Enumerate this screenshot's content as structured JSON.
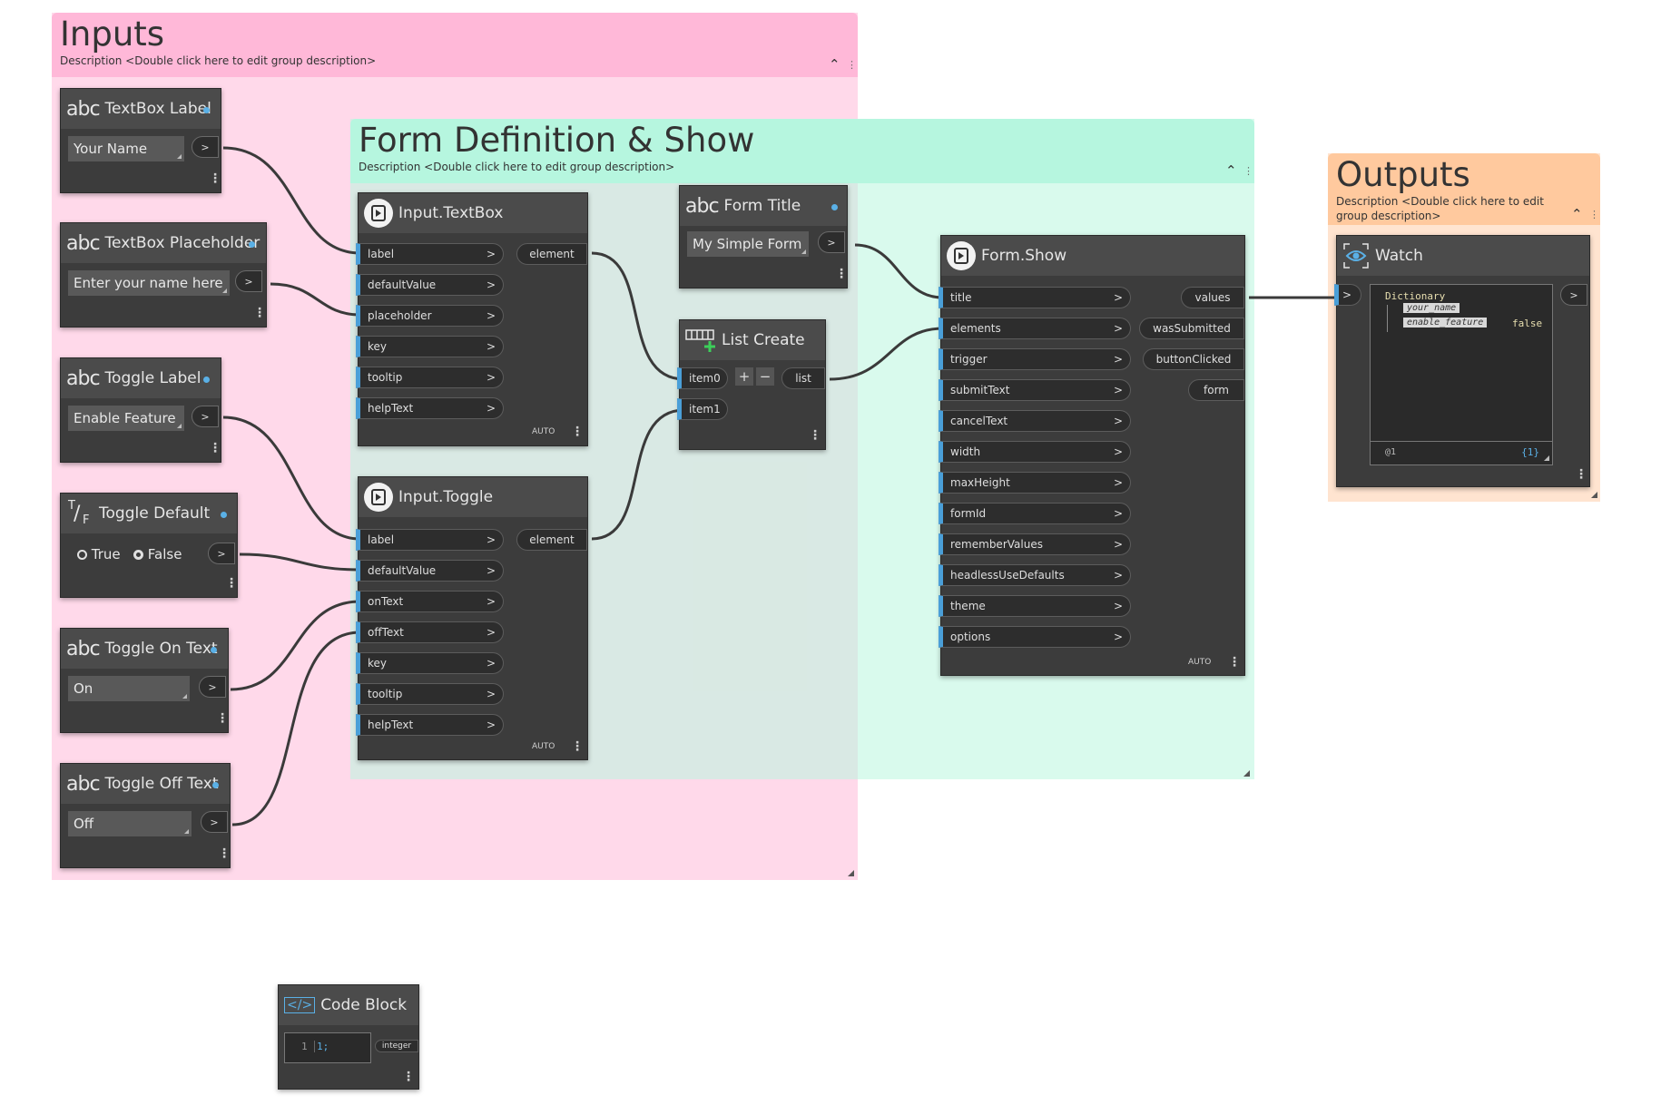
{
  "groups": {
    "inputs": {
      "title": "Inputs",
      "description": "Description <Double click here to edit group description>",
      "color": "#ffb8d8",
      "body_color": "#ffd9ea"
    },
    "form": {
      "title": "Form Definition & Show",
      "description": "Description <Double click here to edit group description>",
      "color": "#b6f6df",
      "body_color": "#dafaee"
    },
    "outputs": {
      "title": "Outputs",
      "description": "Description <Double click here to edit group description>",
      "color": "#ffc99e",
      "body_color": "#ffe4d0"
    }
  },
  "nodes": {
    "textbox_label": {
      "type_icon": "abc",
      "title": "TextBox Label",
      "value": "Your Name",
      "out": ">"
    },
    "textbox_placeholder": {
      "type_icon": "abc",
      "title": "TextBox Placeholder",
      "value": "Enter your name here",
      "out": ">"
    },
    "toggle_label": {
      "type_icon": "abc",
      "title": "Toggle Label",
      "value": "Enable Feature",
      "out": ">"
    },
    "toggle_default": {
      "type_icon": "T/F",
      "icon_t": "T",
      "icon_f": "F",
      "title": "Toggle Default",
      "true_label": "True",
      "false_label": "False",
      "out": ">"
    },
    "toggle_on_text": {
      "type_icon": "abc",
      "title": "Toggle On Text",
      "value": "On",
      "out": ">"
    },
    "toggle_off_text": {
      "type_icon": "abc",
      "title": "Toggle Off Text",
      "value": "Off",
      "out": ">"
    },
    "input_textbox": {
      "title": "Input.TextBox",
      "inputs": [
        "label",
        "defaultValue",
        "placeholder",
        "key",
        "tooltip",
        "helpText"
      ],
      "output": "element",
      "lacing": "AUTO"
    },
    "input_toggle": {
      "title": "Input.Toggle",
      "inputs": [
        "label",
        "defaultValue",
        "onText",
        "offText",
        "key",
        "tooltip",
        "helpText"
      ],
      "output": "element",
      "lacing": "AUTO"
    },
    "form_title": {
      "type_icon": "abc",
      "title": "Form Title",
      "value": "My Simple Form",
      "out": ">"
    },
    "list_create": {
      "title": "List Create",
      "inputs": [
        "item0",
        "item1"
      ],
      "output": "list",
      "add": "+",
      "remove": "−"
    },
    "form_show": {
      "title": "Form.Show",
      "inputs": [
        "title",
        "elements",
        "trigger",
        "submitText",
        "cancelText",
        "width",
        "maxHeight",
        "formId",
        "rememberValues",
        "headlessUseDefaults",
        "theme",
        "options"
      ],
      "outputs": [
        "values",
        "wasSubmitted",
        "buttonClicked",
        "form"
      ],
      "lacing": "AUTO"
    },
    "watch": {
      "title": "Watch",
      "in": ">",
      "out": ">",
      "tree_root": "Dictionary",
      "keys": [
        "your_name",
        "enable_feature"
      ],
      "value_enable_feature": "false",
      "footer_left": "@1",
      "footer_right": "{1}"
    },
    "code_block": {
      "title": "Code Block",
      "icon": "</>",
      "line_no": "1",
      "code": "1;",
      "output": "integer"
    }
  },
  "chevron": ">",
  "collapse_glyph": "^",
  "colors": {
    "node_body": "#3c3c3c",
    "node_header": "#4b4b4b",
    "port_accent": "#4a9fd8",
    "wire": "#3a3a3a"
  }
}
